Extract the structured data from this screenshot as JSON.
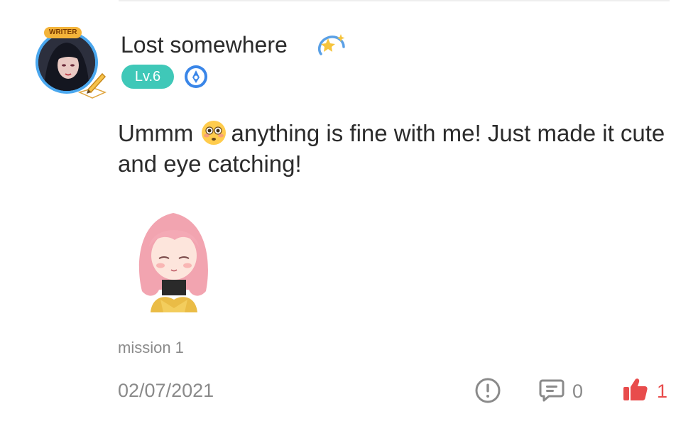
{
  "post": {
    "author": {
      "name": "Lost somewhere",
      "avatar_tag": "WRITER",
      "level": "Lv.6",
      "sparkle_icon": "sparkle-icon",
      "rank_icon": "rank-emblem-icon"
    },
    "content": {
      "before_emoji": "Ummm",
      "emoji": "flushed-face-emoji",
      "after_emoji": "anything is fine with me! Just made it cute and eye catching!"
    },
    "sticker": "anime-girl-sticker",
    "tag": "mission 1",
    "date": "02/07/2021",
    "actions": {
      "report_icon": "report-icon",
      "comment_icon": "comment-icon",
      "comment_count": "0",
      "like_icon": "thumbs-up-icon",
      "like_count": "1"
    }
  },
  "colors": {
    "level_badge": "#3fc8b8",
    "avatar_ring": "#4aa7ee",
    "like": "#e84c4c",
    "muted_text": "#8a8a8a",
    "text": "#2b2b2b"
  }
}
